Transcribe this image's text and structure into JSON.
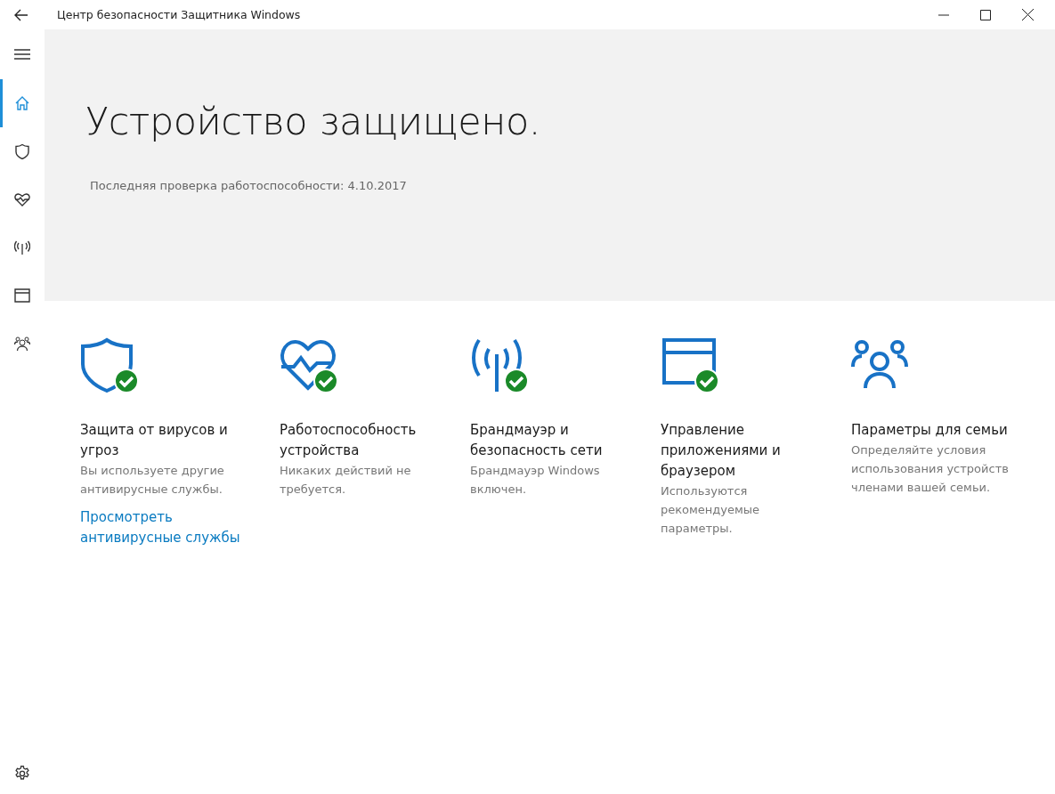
{
  "window": {
    "title": "Центр безопасности Защитника Windows"
  },
  "nav": [
    {
      "kind": "menu",
      "selected": false
    },
    {
      "kind": "home",
      "selected": true
    },
    {
      "kind": "shield",
      "selected": false
    },
    {
      "kind": "heart",
      "selected": false
    },
    {
      "kind": "antenna",
      "selected": false
    },
    {
      "kind": "browser",
      "selected": false
    },
    {
      "kind": "family",
      "selected": false
    }
  ],
  "hero": {
    "heading": "Устройство защищено.",
    "last_check": "Последняя проверка работоспособности:  4.10.2017"
  },
  "tiles": [
    {
      "kind": "shield",
      "ok": true,
      "title": "Защита от вирусов и угроз",
      "description": "Вы используете другие антивирусные службы.",
      "link": "Просмотреть антивирусные службы"
    },
    {
      "kind": "heart",
      "ok": true,
      "title": "Работоспособность устройства",
      "description": "Никаких действий не требуется."
    },
    {
      "kind": "antenna",
      "ok": true,
      "title": "Брандмауэр и безопасность сети",
      "description": "Брандмауэр Windows включен."
    },
    {
      "kind": "browser",
      "ok": true,
      "title": "Управление приложениями и браузером",
      "description": "Используются рекомендуемые параметры."
    },
    {
      "kind": "family",
      "ok": false,
      "title": "Параметры для семьи",
      "description": "Определяйте условия использования устройств членами вашей семьи."
    }
  ]
}
